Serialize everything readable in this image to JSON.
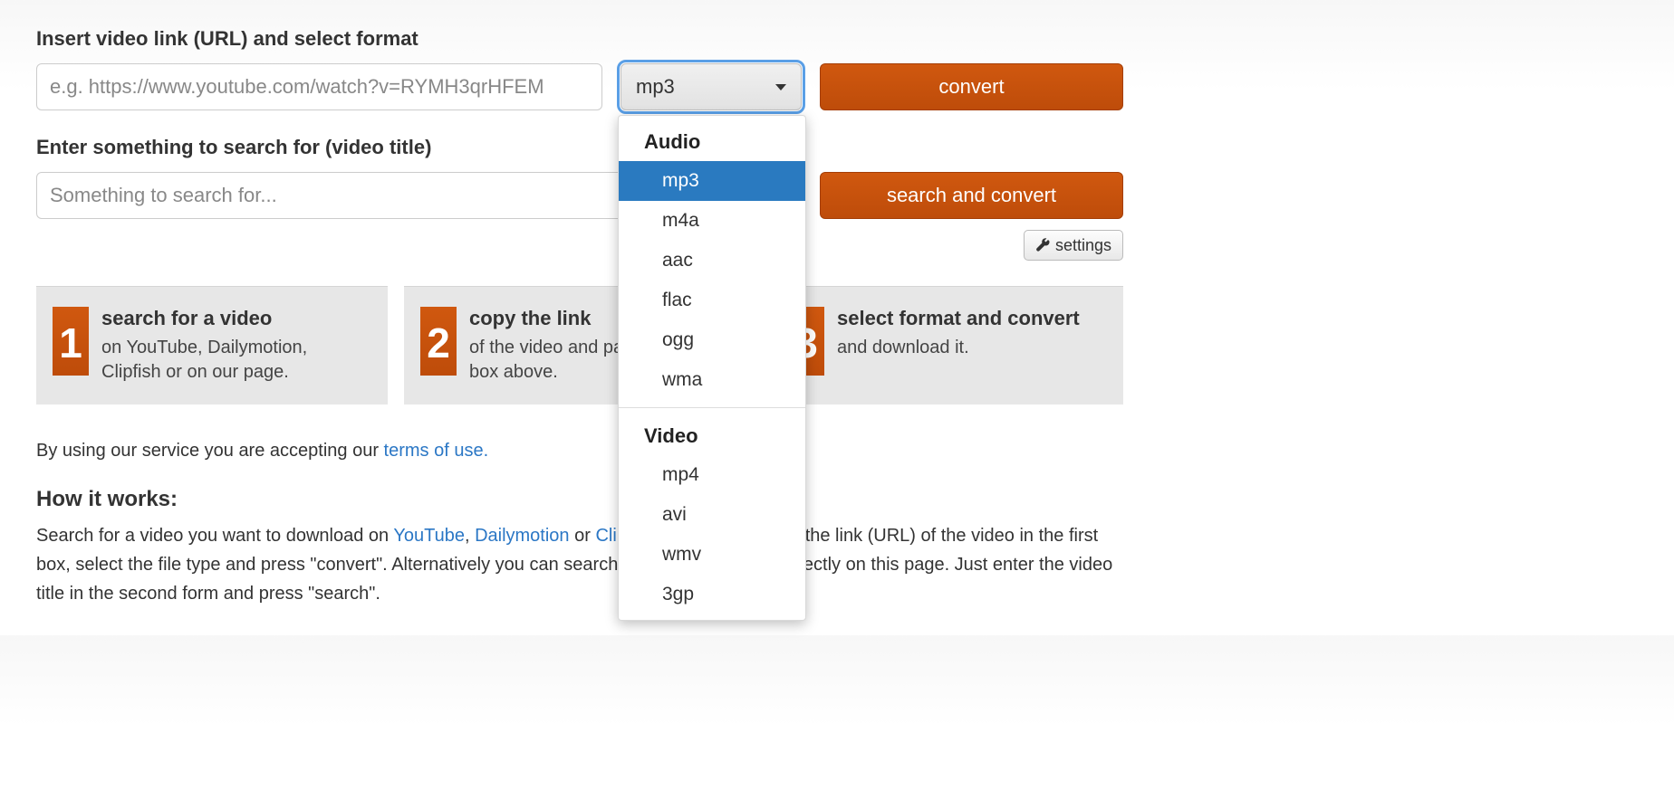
{
  "url_section": {
    "label": "Insert video link (URL) and select format",
    "placeholder": "e.g. https://www.youtube.com/watch?v=RYMH3qrHFEM",
    "format_value": "mp3",
    "convert_label": "convert"
  },
  "search_section": {
    "label": "Enter something to search for (video title)",
    "placeholder": "Something to search for...",
    "search_convert_label": "search and convert"
  },
  "settings_label": "settings",
  "dropdown": {
    "groups": [
      {
        "header": "Audio",
        "items": [
          "mp3",
          "m4a",
          "aac",
          "flac",
          "ogg",
          "wma"
        ]
      },
      {
        "header": "Video",
        "items": [
          "mp4",
          "avi",
          "wmv",
          "3gp"
        ]
      }
    ],
    "selected": "mp3"
  },
  "steps": [
    {
      "num": "1",
      "title": "search for a video",
      "desc": "on YouTube, Dailymotion, Clipfish or on our page."
    },
    {
      "num": "2",
      "title": "copy the link",
      "desc": "of the video and paste it into the box above."
    },
    {
      "num": "3",
      "title": "select format and convert",
      "desc": "and download it."
    }
  ],
  "terms": {
    "prefix": "By using our service you are accepting our ",
    "link_text": "terms of use."
  },
  "how": {
    "title": "How it works:",
    "p1a": "Search for a video you want to download on ",
    "yt": "YouTube",
    "comma": ", ",
    "dm": "Dailymotion",
    "p1b": " or ",
    "cf": "Clipfish",
    "p1c": " and copy & paste the link (URL) of the video in the first box, select the file type and press \"convert\". Alternatively you can search for a Youtube video directly on this page. Just enter the video title in the second form and press \"search\"."
  }
}
